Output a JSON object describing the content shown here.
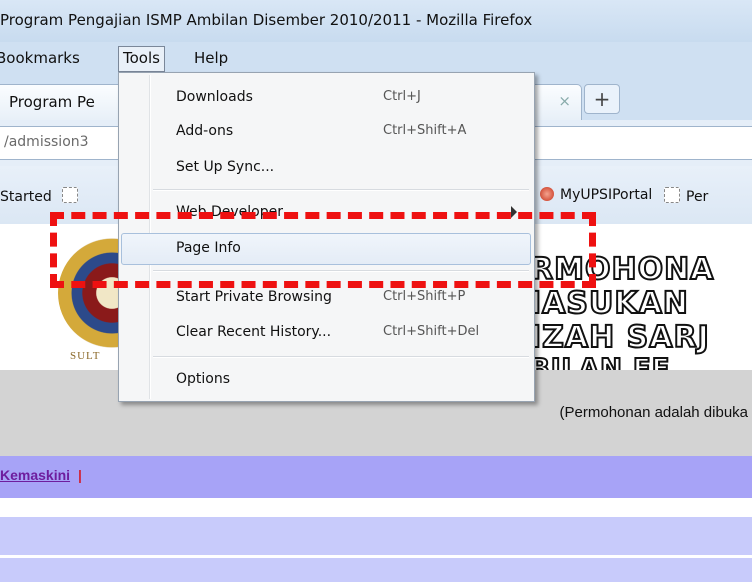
{
  "window": {
    "title": "Program Pengajian ISMP Ambilan Disember 2010/2011 - Mozilla Firefox"
  },
  "menubar": {
    "items": [
      {
        "label": "Bookmarks"
      },
      {
        "label": "Tools"
      },
      {
        "label": "Help"
      }
    ]
  },
  "tabs": [
    {
      "label": "Program Pe"
    }
  ],
  "tab_close_symbol": "×",
  "new_tab_symbol": "+",
  "url": {
    "value": "/admission3"
  },
  "bookmarks": [
    {
      "label": "Started",
      "icon": "blank-page-icon"
    },
    {
      "label": "MyUPSIPortal",
      "icon": "portal-icon"
    },
    {
      "label": "Per",
      "icon": "blank-page-icon"
    }
  ],
  "tools_menu": {
    "items": [
      {
        "label": "Downloads",
        "shortcut": "Ctrl+J"
      },
      {
        "label": "Add-ons",
        "shortcut": "Ctrl+Shift+A"
      },
      {
        "label": "Set Up Sync...",
        "shortcut": ""
      },
      {
        "label": "Web Developer",
        "shortcut": ""
      },
      {
        "label": "Page Info",
        "shortcut": ""
      },
      {
        "label": "Start Private Browsing",
        "shortcut": "Ctrl+Shift+P"
      },
      {
        "label": "Clear Recent History...",
        "shortcut": "Ctrl+Shift+Del"
      },
      {
        "label": "Options",
        "shortcut": ""
      }
    ],
    "highlighted": "Page Info"
  },
  "page": {
    "banner_lines": [
      "RMOHONA",
      "IASUKAN",
      "IZAH SARJ",
      "BILAN FE"
    ],
    "logo_caption": "SULT",
    "notice": "(Permohonan adalah dibuka",
    "nav_link": "Kemaskini",
    "nav_separator": "|"
  },
  "colors": {
    "annotation": "#ee1111",
    "nav_background": "#a7a3f7",
    "nav_link": "#6e1d9e"
  }
}
